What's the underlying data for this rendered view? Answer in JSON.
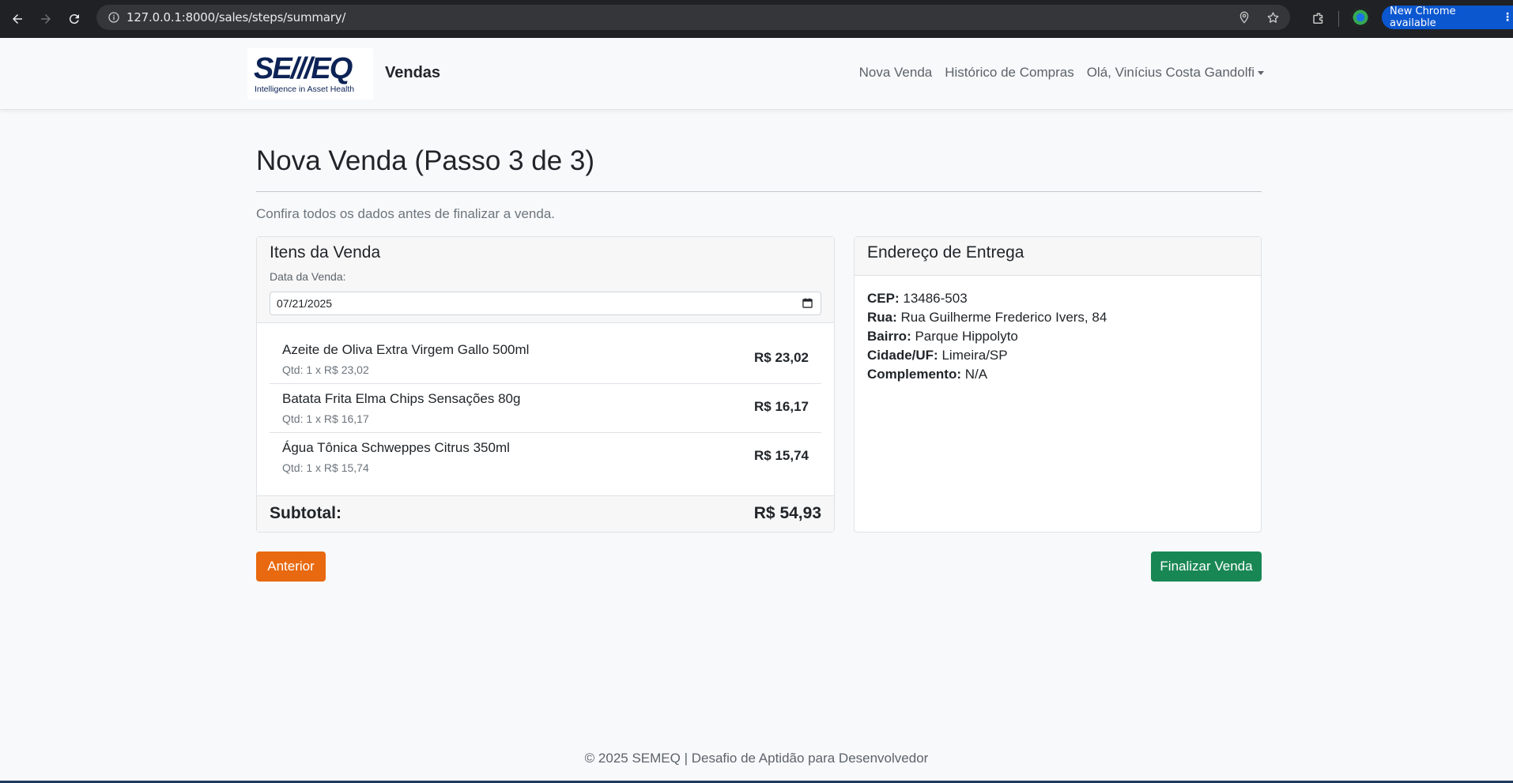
{
  "browser": {
    "url": "127.0.0.1:8000/sales/steps/summary/",
    "update_label": "New Chrome available"
  },
  "site": {
    "logo_mark": "SE///EQ",
    "logo_tagline": "Intelligence in Asset Health",
    "brand": "Vendas",
    "nav": {
      "new_sale": "Nova Venda",
      "history": "Histórico de Compras",
      "user": "Olá, Vinícius Costa Gandolfi"
    }
  },
  "page": {
    "title": "Nova Venda (Passo 3 de 3)",
    "lead": "Confira todos os dados antes de finalizar a venda."
  },
  "items_card": {
    "title": "Itens da Venda",
    "date_label": "Data da Venda:",
    "date_value": "07/21/2025",
    "items": [
      {
        "name": "Azeite de Oliva Extra Virgem Gallo 500ml",
        "qty": "Qtd: 1 x R$ 23,02",
        "price": "R$ 23,02"
      },
      {
        "name": "Batata Frita Elma Chips Sensações 80g",
        "qty": "Qtd: 1 x R$ 16,17",
        "price": "R$ 16,17"
      },
      {
        "name": "Água Tônica Schweppes Citrus 350ml",
        "qty": "Qtd: 1 x R$ 15,74",
        "price": "R$ 15,74"
      }
    ],
    "subtotal_label": "Subtotal:",
    "subtotal_value": "R$ 54,93"
  },
  "address_card": {
    "title": "Endereço de Entrega",
    "cep_label": "CEP:",
    "cep": "13486-503",
    "rua_label": "Rua:",
    "rua": "Rua Guilherme Frederico Ivers, 84",
    "bairro_label": "Bairro:",
    "bairro": "Parque Hippolyto",
    "cidade_label": "Cidade/UF:",
    "cidade": "Limeira/SP",
    "complemento_label": "Complemento:",
    "complemento": "N/A"
  },
  "buttons": {
    "previous": "Anterior",
    "finish": "Finalizar Venda"
  },
  "footer": "© 2025 SEMEQ | Desafio de Aptidão para Desenvolvedor",
  "colors": {
    "prev_button": "#e8690f",
    "finish_button": "#198754",
    "logo_navy": "#0d2356"
  }
}
